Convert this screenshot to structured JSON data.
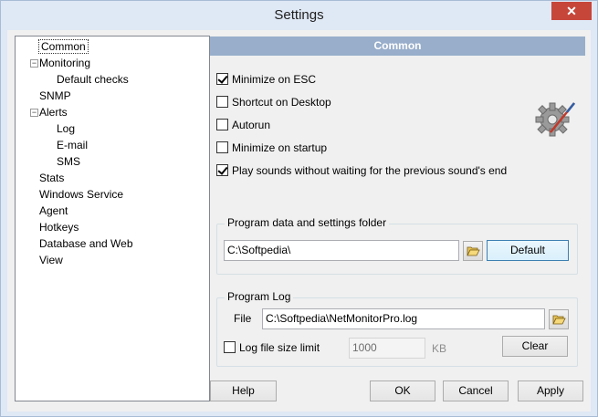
{
  "window": {
    "title": "Settings",
    "close_glyph": "✕"
  },
  "tree": {
    "items": [
      {
        "label": "Common",
        "level": 0,
        "selected": true
      },
      {
        "label": "Monitoring",
        "level": 0,
        "toggle": "−"
      },
      {
        "label": "Default checks",
        "level": 1
      },
      {
        "label": "SNMP",
        "level": 0
      },
      {
        "label": "Alerts",
        "level": 0,
        "toggle": "−"
      },
      {
        "label": "Log",
        "level": 1
      },
      {
        "label": "E-mail",
        "level": 1
      },
      {
        "label": "SMS",
        "level": 1
      },
      {
        "label": "Stats",
        "level": 0
      },
      {
        "label": "Windows Service",
        "level": 0
      },
      {
        "label": "Agent",
        "level": 0
      },
      {
        "label": "Hotkeys",
        "level": 0
      },
      {
        "label": "Database and Web",
        "level": 0
      },
      {
        "label": "View",
        "level": 0
      }
    ]
  },
  "panel": {
    "header": "Common",
    "icon": "gear-icon",
    "options": [
      {
        "label": "Minimize on ESC",
        "checked": true
      },
      {
        "label": "Shortcut on Desktop",
        "checked": false
      },
      {
        "label": "Autorun",
        "checked": false
      },
      {
        "label": "Minimize on startup",
        "checked": false
      },
      {
        "label": "Play sounds without waiting for the previous sound's end",
        "checked": true
      }
    ],
    "data_folder": {
      "title": "Program data and settings folder",
      "path": "C:\\Softpedia\\",
      "browse_icon": "folder-open-icon",
      "default_label": "Default"
    },
    "program_log": {
      "title": "Program Log",
      "file_label": "File",
      "file_path": "C:\\Softpedia\\NetMonitorPro.log",
      "browse_icon": "folder-open-icon",
      "limit_label": "Log file size limit",
      "limit_checked": false,
      "limit_value": "1000",
      "limit_unit": "KB",
      "clear_label": "Clear"
    }
  },
  "footer": {
    "help_label": "Help",
    "ok_label": "OK",
    "cancel_label": "Cancel",
    "apply_label": "Apply"
  }
}
